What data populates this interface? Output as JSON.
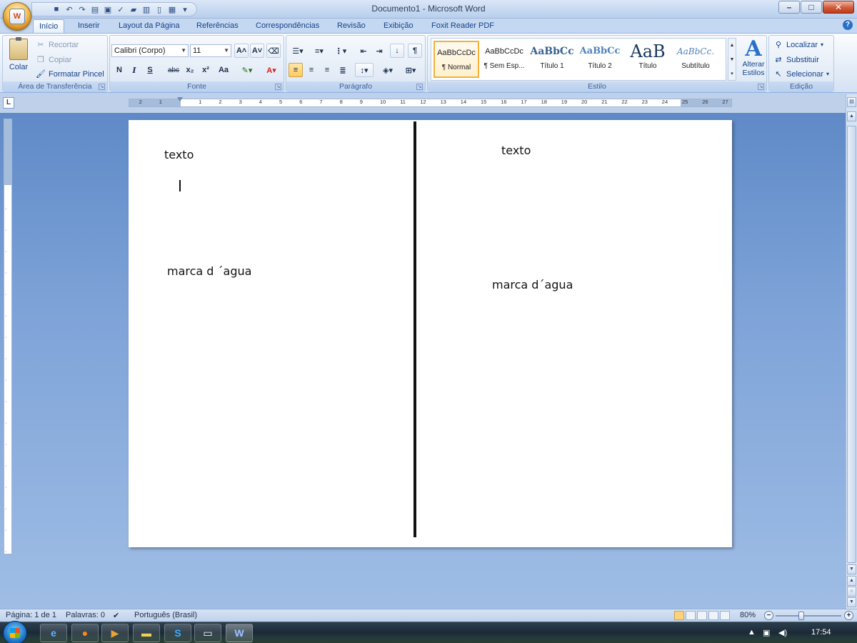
{
  "window": {
    "title": "Documento1 - Microsoft Word",
    "minimize": "–",
    "maximize": "□",
    "close": "✕"
  },
  "tabs": [
    {
      "label": "Início",
      "active": true
    },
    {
      "label": "Inserir"
    },
    {
      "label": "Layout da Página"
    },
    {
      "label": "Referências"
    },
    {
      "label": "Correspondências"
    },
    {
      "label": "Revisão"
    },
    {
      "label": "Exibição"
    },
    {
      "label": "Foxit Reader PDF"
    }
  ],
  "clipboard": {
    "group_label": "Área de Transferência",
    "paste": "Colar",
    "cut": "Recortar",
    "copy": "Copiar",
    "format_painter": "Formatar Pincel"
  },
  "font": {
    "group_label": "Fonte",
    "font_name": "Calibri (Corpo)",
    "font_size": "11",
    "bold": "N",
    "italic": "I",
    "underline": "S",
    "strike": "abc",
    "subscript": "x₂",
    "superscript": "x²",
    "change_case": "Aa",
    "grow": "A˄",
    "shrink": "A˅"
  },
  "paragraph": {
    "group_label": "Parágrafo"
  },
  "styles": {
    "group_label": "Estilo",
    "items": [
      {
        "preview": "AaBbCcDc",
        "name": "¶ Normal"
      },
      {
        "preview": "AaBbCcDc",
        "name": "¶ Sem Esp..."
      },
      {
        "preview": "AaBbCc",
        "name": "Título 1"
      },
      {
        "preview": "AaBbCc",
        "name": "Título 2"
      },
      {
        "preview": "AaB",
        "name": "Título"
      },
      {
        "preview": "AaBbCc.",
        "name": "Subtítulo"
      }
    ],
    "change_styles": "Alterar Estilos"
  },
  "editing": {
    "group_label": "Edição",
    "find": "Localizar",
    "replace": "Substituir",
    "select": "Selecionar"
  },
  "ruler": {
    "left_labels": [
      "2",
      "1"
    ],
    "right_labels": [
      "1",
      "2",
      "3",
      "4",
      "5",
      "6",
      "7",
      "8",
      "9",
      "10",
      "11",
      "12",
      "13",
      "14",
      "15",
      "16",
      "17",
      "18",
      "19",
      "20",
      "21",
      "22",
      "23",
      "24",
      "25",
      "26",
      "27"
    ]
  },
  "document": {
    "left_title": "texto",
    "left_watermark": "marca d ´agua",
    "right_title": "texto",
    "right_watermark": "marca d´agua"
  },
  "status": {
    "page": "Página: 1 de 1",
    "words": "Palavras: 0",
    "language": "Português (Brasil)",
    "zoom": "80%"
  },
  "tray": {
    "time": "17:54"
  }
}
